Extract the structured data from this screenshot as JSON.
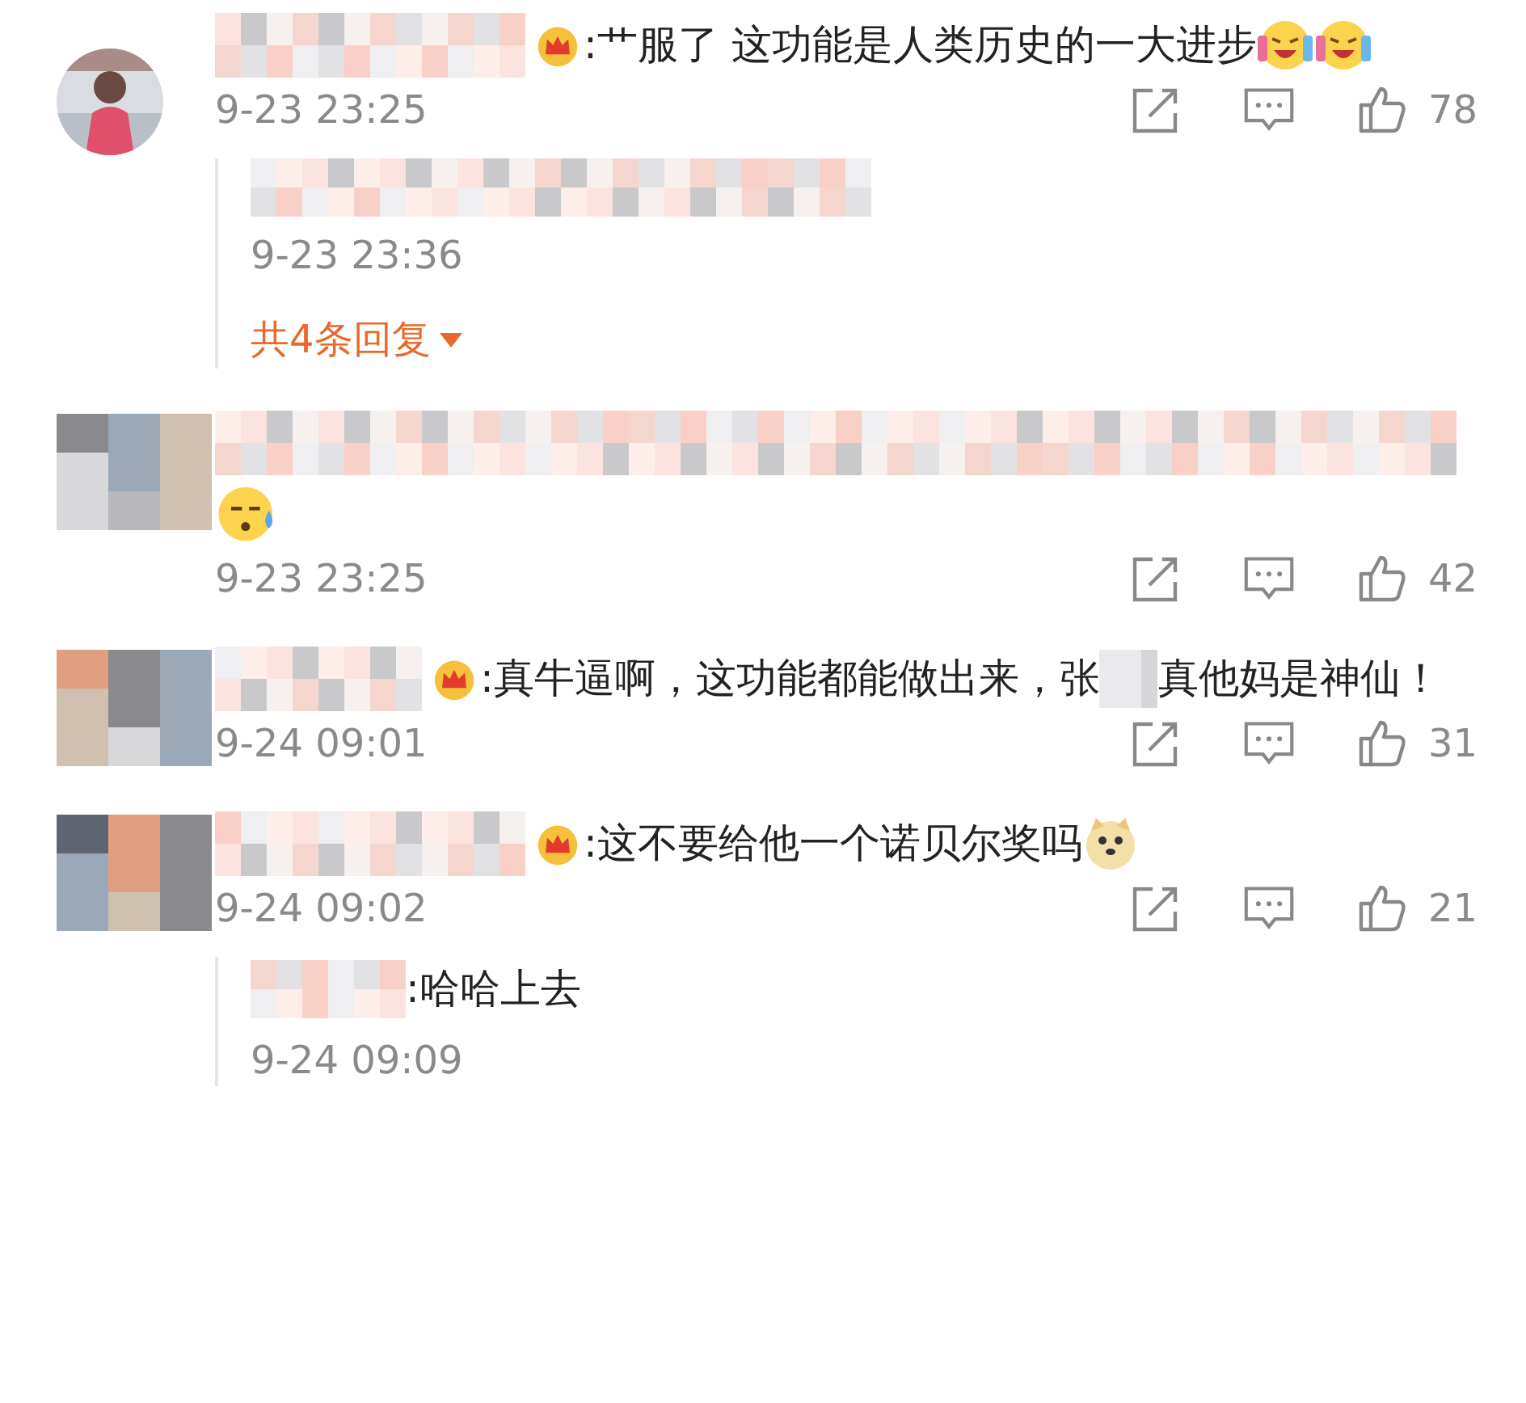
{
  "comments": [
    {
      "badge": true,
      "body": [
        {
          "kind": "text",
          "text": ":艹服了 这功能是人类历史的一大进步"
        },
        {
          "kind": "emoji_laugh"
        },
        {
          "kind": "emoji_laugh"
        }
      ],
      "time": "9-23 23:25",
      "likes": "78",
      "replies": [
        {
          "time": "9-23 23:36"
        }
      ],
      "more_replies": "共4条回复"
    },
    {
      "kind": "mosaic",
      "badge": false,
      "body": [
        {
          "kind": "emoji_sweat"
        }
      ],
      "time": "9-23 23:25",
      "likes": "42"
    },
    {
      "kind": "mosaic",
      "badge": true,
      "body": [
        {
          "kind": "text",
          "text": ":真牛逼啊，这功能都能做出来，张"
        },
        {
          "kind": "blur"
        },
        {
          "kind": "text",
          "text": "真他妈是神"
        },
        {
          "kind": "text",
          "text": "仙！"
        }
      ],
      "time": "9-24 09:01",
      "likes": "31"
    },
    {
      "kind": "mosaic",
      "badge": true,
      "body": [
        {
          "kind": "text",
          "text": ":这不要给他一个诺贝尔奖吗"
        },
        {
          "kind": "emoji_doge"
        }
      ],
      "time": "9-24 09:02",
      "likes": "21",
      "replies": [
        {
          "body": [
            {
              "kind": "text",
              "text": ":哈哈上去"
            }
          ],
          "time": "9-24 09:09"
        }
      ]
    }
  ]
}
